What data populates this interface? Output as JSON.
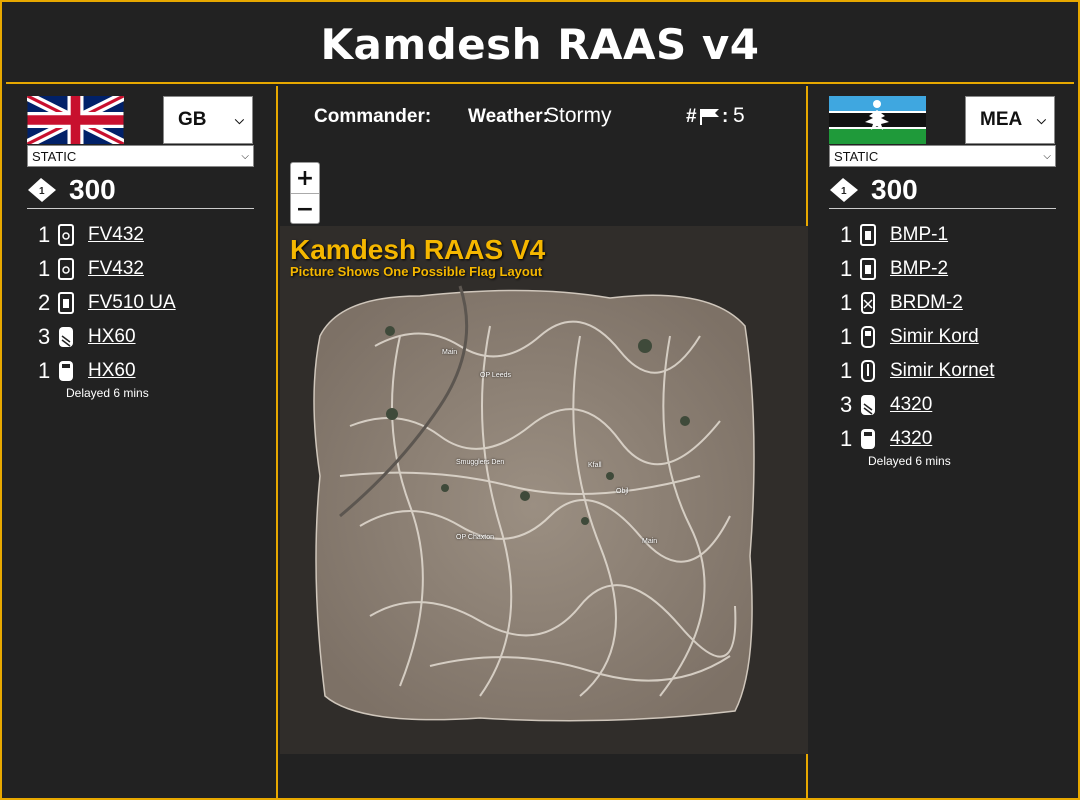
{
  "page_title": "Kamdesh RAAS v4",
  "colors": {
    "accent": "#e8a800",
    "background": "#222222",
    "map_title": "#f5b700"
  },
  "left": {
    "faction": "GB",
    "mode": "STATIC",
    "tickets": "300",
    "units": [
      {
        "count": "1",
        "name": "FV432",
        "icon": "tracked-apc-icon"
      },
      {
        "count": "1",
        "name": "FV432",
        "icon": "tracked-apc-icon"
      },
      {
        "count": "2",
        "name": "FV510 UA",
        "icon": "tracked-ifv-icon"
      },
      {
        "count": "3",
        "name": "HX60",
        "icon": "logistics-truck-icon"
      },
      {
        "count": "1",
        "name": "HX60",
        "icon": "transport-truck-icon"
      }
    ],
    "delay_note": "Delayed 6 mins"
  },
  "right": {
    "faction": "MEA",
    "mode": "STATIC",
    "tickets": "300",
    "units": [
      {
        "count": "1",
        "name": "BMP-1",
        "icon": "tracked-ifv-icon"
      },
      {
        "count": "1",
        "name": "BMP-2",
        "icon": "tracked-ifv-icon"
      },
      {
        "count": "1",
        "name": "BRDM-2",
        "icon": "wheeled-recon-icon"
      },
      {
        "count": "1",
        "name": "Simir Kord",
        "icon": "armed-car-icon"
      },
      {
        "count": "1",
        "name": "Simir Kornet",
        "icon": "atgm-car-icon"
      },
      {
        "count": "3",
        "name": "4320",
        "icon": "logistics-truck-icon"
      },
      {
        "count": "1",
        "name": "4320",
        "icon": "transport-truck-icon"
      }
    ],
    "delay_note": "Delayed 6 mins"
  },
  "center": {
    "commander_label": "Commander:",
    "commander_value": "",
    "weather_label": "Weather:",
    "weather_value": "Stormy",
    "flags_label": "#",
    "flags_colon": ":",
    "flags_value": "5",
    "zoom_in": "+",
    "zoom_out": "−"
  },
  "map": {
    "title": "Kamdesh RAAS V4",
    "subtitle": "Picture Shows One Possible Flag Layout",
    "flags": [
      {
        "label": "Main"
      },
      {
        "label": "OP Leeds"
      },
      {
        "label": "Smugglers Den"
      },
      {
        "label": "Kfall"
      },
      {
        "label": "Objl"
      },
      {
        "label": "OP Chaxton"
      },
      {
        "label": "Main"
      }
    ]
  }
}
